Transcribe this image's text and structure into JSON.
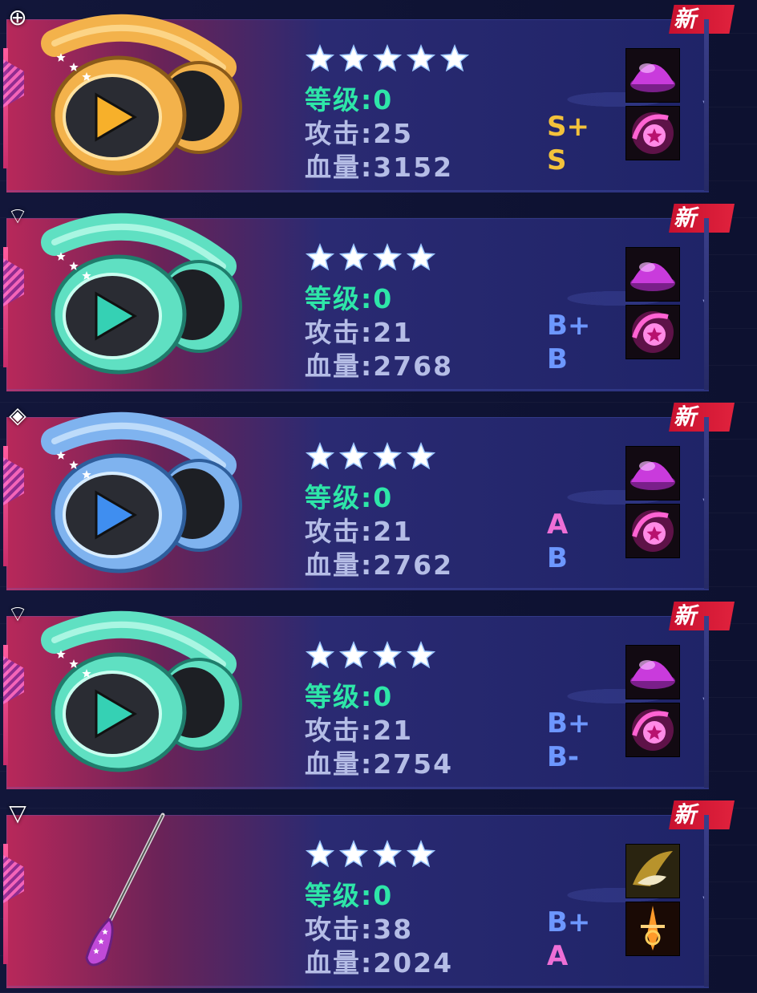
{
  "colors": {
    "level": "#2ee6a8",
    "stat": "#b5bde6",
    "grade_s": "#f3c23b",
    "grade_b": "#6d97ff",
    "grade_a": "#ee6fd6",
    "new_tag": "#d9162f"
  },
  "items": [
    {
      "type": "headphones",
      "tint": "gold",
      "corner_icon": "locate-icon",
      "stars": 5,
      "level": "等级:0",
      "attack": "攻击:25",
      "hp": "血量:3152",
      "attack_grade": "S+",
      "hp_grade": "S",
      "attack_grade_color": "#f3c23b",
      "hp_grade_color": "#f3c23b",
      "new_label": "新",
      "skills": [
        "purple-dome-skill-icon",
        "pink-star-swirl-skill-icon"
      ]
    },
    {
      "type": "headphones",
      "tint": "mint",
      "corner_icon": "wifi-icon",
      "stars": 4,
      "level": "等级:0",
      "attack": "攻击:21",
      "hp": "血量:2768",
      "attack_grade": "B+",
      "hp_grade": "B",
      "attack_grade_color": "#6d97ff",
      "hp_grade_color": "#6d97ff",
      "new_label": "新",
      "skills": [
        "purple-dome-skill-icon",
        "pink-star-swirl-skill-icon"
      ]
    },
    {
      "type": "headphones",
      "tint": "blue",
      "corner_icon": "diamond-target-icon",
      "stars": 4,
      "level": "等级:0",
      "attack": "攻击:21",
      "hp": "血量:2762",
      "attack_grade": "A",
      "hp_grade": "B",
      "attack_grade_color": "#ee6fd6",
      "hp_grade_color": "#6d97ff",
      "new_label": "新",
      "skills": [
        "purple-dome-skill-icon",
        "pink-star-swirl-skill-icon"
      ]
    },
    {
      "type": "headphones",
      "tint": "mint",
      "corner_icon": "wifi-icon",
      "stars": 4,
      "level": "等级:0",
      "attack": "攻击:21",
      "hp": "血量:2754",
      "attack_grade": "B+",
      "hp_grade": "B-",
      "attack_grade_color": "#6d97ff",
      "hp_grade_color": "#6d97ff",
      "new_label": "新",
      "skills": [
        "purple-dome-skill-icon",
        "pink-star-swirl-skill-icon"
      ]
    },
    {
      "type": "wand",
      "tint": "purple",
      "corner_icon": "triangle-down-icon",
      "stars": 4,
      "level": "等级:0",
      "attack": "攻击:38",
      "hp": "血量:2024",
      "attack_grade": "B+",
      "hp_grade": "A",
      "attack_grade_color": "#6d97ff",
      "hp_grade_color": "#ee6fd6",
      "new_label": "新",
      "skills": [
        "golden-swipe-skill-icon",
        "flaming-sword-skill-icon"
      ]
    }
  ]
}
